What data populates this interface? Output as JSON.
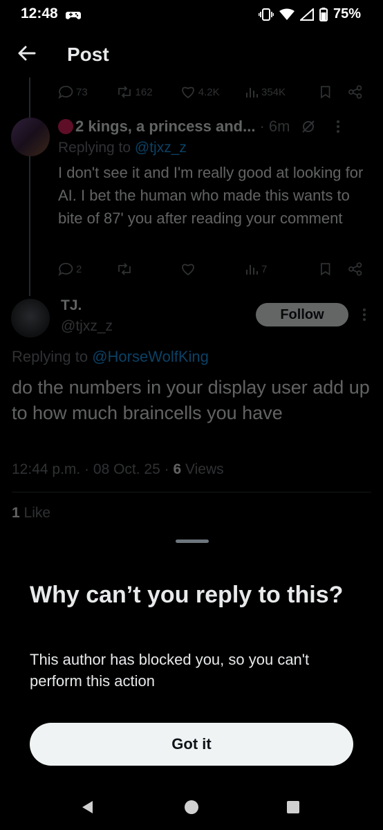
{
  "status_bar": {
    "time": "12:48",
    "battery": "75%"
  },
  "header": {
    "title": "Post"
  },
  "prev_tweet_actions": {
    "replies": "73",
    "reposts": "162",
    "likes": "4.2K",
    "views": "354K"
  },
  "reply_tweet": {
    "display_name": "2 kings, a princess and...",
    "time": "· 6m",
    "replying_prefix": "Replying to",
    "replying_handle": "@tjxz_z",
    "text": "I don't see it and I'm really good at looking for AI. I bet the human who made this wants to bite of 87' you after reading your comment",
    "actions": {
      "replies": "2",
      "reposts": "",
      "likes": "",
      "views": "7"
    }
  },
  "main_tweet": {
    "display_name": "TJ.",
    "handle": "@tjxz_z",
    "follow_label": "Follow",
    "replying_prefix": "Replying to",
    "replying_handle": "@HorseWolfKing",
    "text": "do the numbers in your display user add up to how much braincells you have",
    "timestamp": "12:44 p.m. · 08 Oct. 25 ·",
    "views_count": "6",
    "views_label": "Views",
    "likes_count": "1",
    "likes_label": "Like"
  },
  "sheet": {
    "title": "Why can’t you reply to this?",
    "body": "This author has blocked you, so you can't perform this action",
    "button_label": "Got it"
  },
  "colors": {
    "accent": "#1d9bf0",
    "background": "#000000",
    "record_dot": "#e0245e"
  }
}
